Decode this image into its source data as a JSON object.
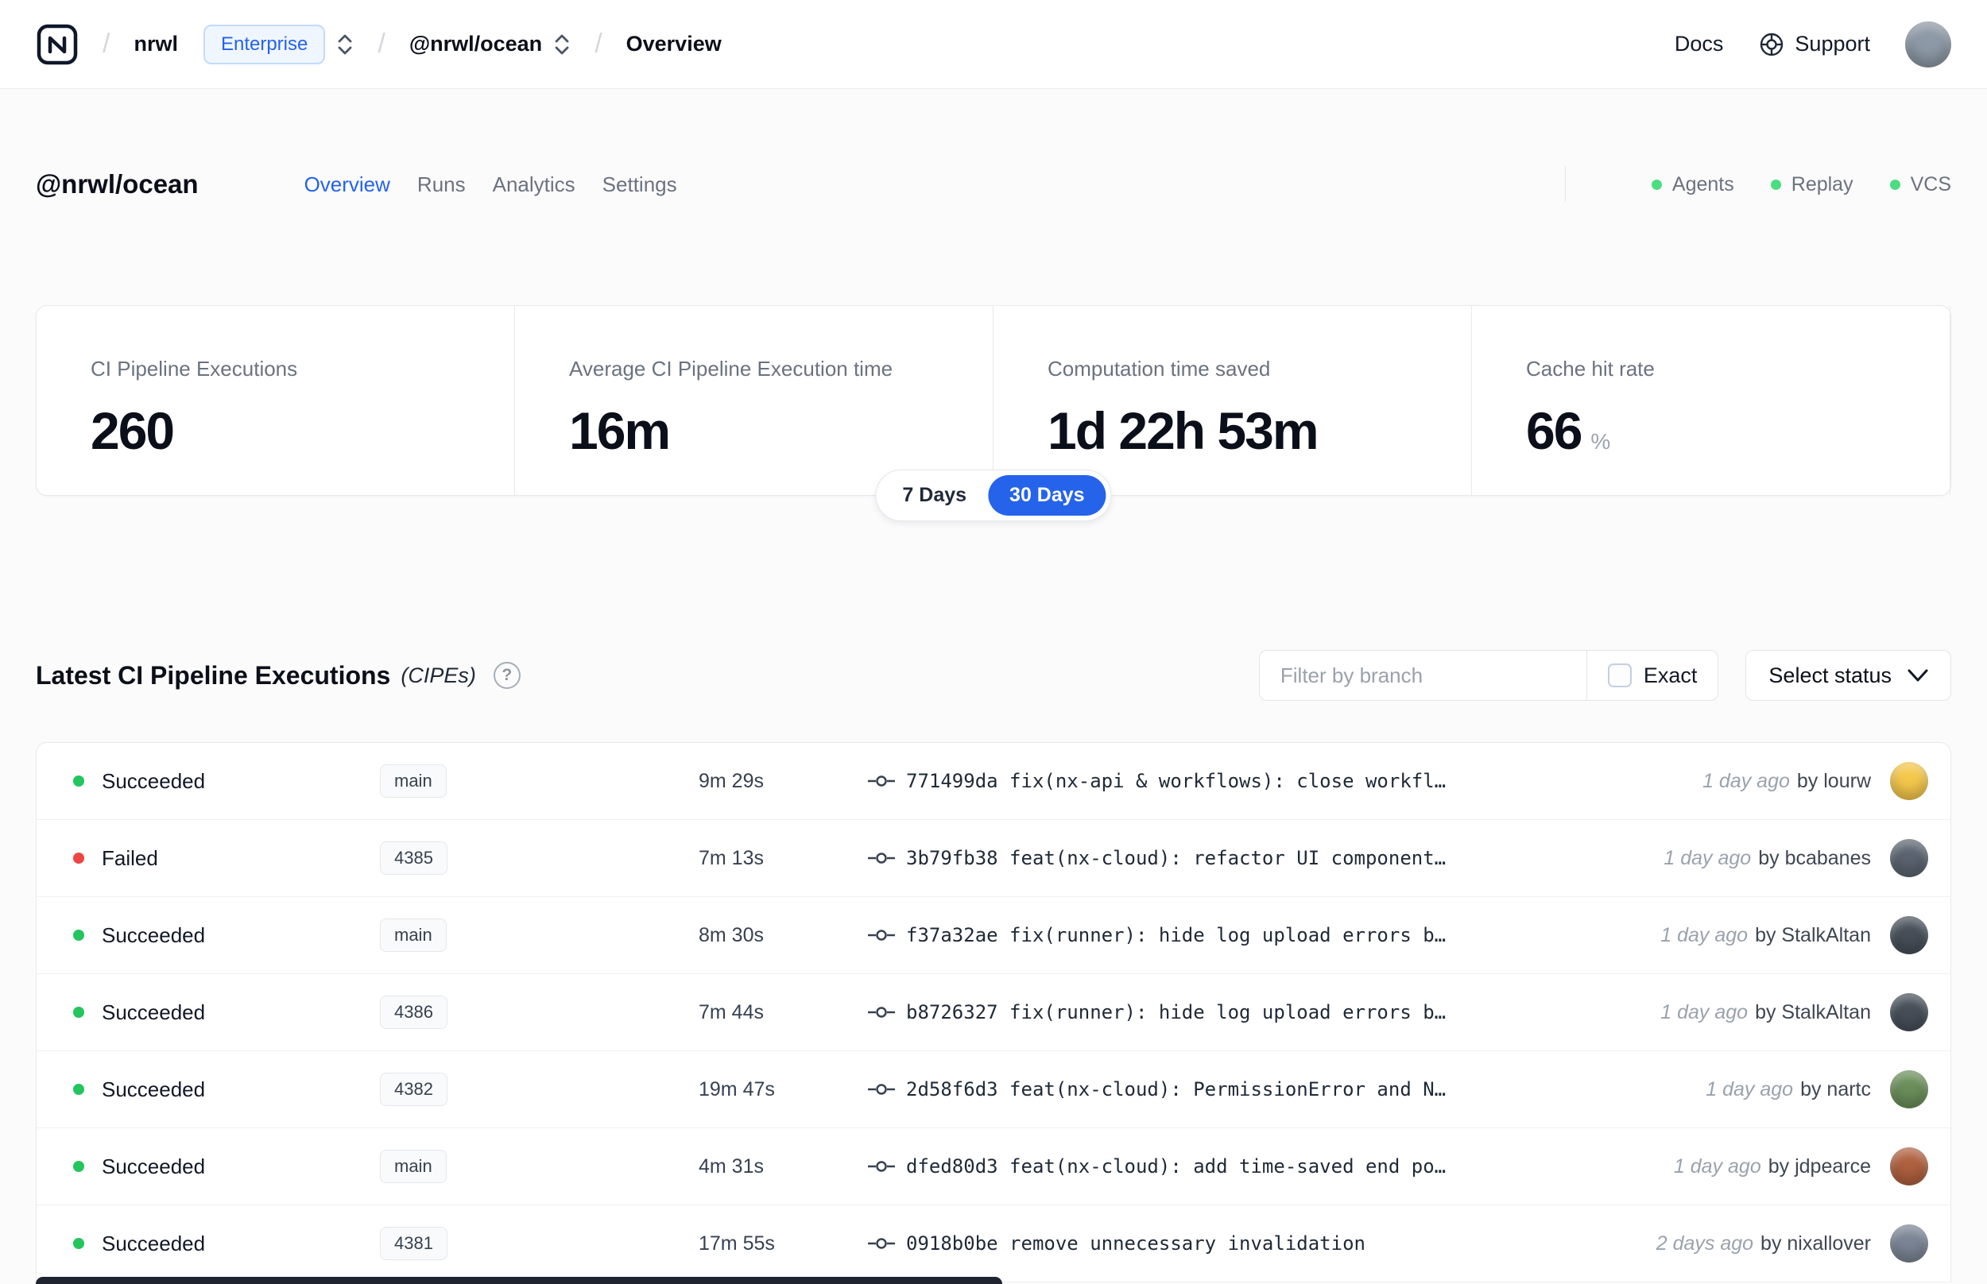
{
  "theme": {
    "accent": "#2563eb",
    "success": "#22c55e",
    "danger": "#ef4444"
  },
  "navbar": {
    "separator": "/",
    "org": "nrwl",
    "org_badge": "Enterprise",
    "workspace": "@nrwl/ocean",
    "current_page": "Overview",
    "docs_label": "Docs",
    "support_label": "Support",
    "avatar_color": "#8d99a6"
  },
  "header": {
    "title": "@nrwl/ocean",
    "tabs": [
      {
        "label": "Overview",
        "active": true
      },
      {
        "label": "Runs",
        "active": false
      },
      {
        "label": "Analytics",
        "active": false
      },
      {
        "label": "Settings",
        "active": false
      }
    ],
    "statuses": [
      {
        "label": "Agents",
        "color": "#4ade80"
      },
      {
        "label": "Replay",
        "color": "#4ade80"
      },
      {
        "label": "VCS",
        "color": "#4ade80"
      }
    ]
  },
  "metrics": {
    "cards": [
      {
        "label": "CI Pipeline Executions",
        "value": "260",
        "suffix": ""
      },
      {
        "label": "Average CI Pipeline Execution time",
        "value": "16m",
        "suffix": ""
      },
      {
        "label": "Computation time saved",
        "value": "1d 22h 53m",
        "suffix": ""
      },
      {
        "label": "Cache hit rate",
        "value": "66",
        "suffix": "%"
      }
    ],
    "range_options": [
      {
        "label": "7 Days",
        "active": false
      },
      {
        "label": "30 Days",
        "active": true
      }
    ]
  },
  "cipes": {
    "title": "Latest CI Pipeline Executions",
    "subtitle": "(CIPEs)",
    "help_icon": "?",
    "filter_placeholder": "Filter by branch",
    "exact_label": "Exact",
    "status_dropdown_label": "Select status",
    "rows": [
      {
        "status": "Succeeded",
        "dot": "#22c55e",
        "branch": "main",
        "duration": "9m 29s",
        "commit": "771499da fix(nx-api & workflows): close workfl…",
        "time": "1 day ago",
        "author": "by lourw",
        "avatar_color": "#f6c84c"
      },
      {
        "status": "Failed",
        "dot": "#ef4444",
        "branch": "4385",
        "duration": "7m 13s",
        "commit": "3b79fb38 feat(nx-cloud): refactor UI component…",
        "time": "1 day ago",
        "author": "by bcabanes",
        "avatar_color": "#5b6470"
      },
      {
        "status": "Succeeded",
        "dot": "#22c55e",
        "branch": "main",
        "duration": "8m 30s",
        "commit": "f37a32ae fix(runner): hide log upload errors b…",
        "time": "1 day ago",
        "author": "by StalkAltan",
        "avatar_color": "#474f59"
      },
      {
        "status": "Succeeded",
        "dot": "#22c55e",
        "branch": "4386",
        "duration": "7m 44s",
        "commit": "b8726327 fix(runner): hide log upload errors b…",
        "time": "1 day ago",
        "author": "by StalkAltan",
        "avatar_color": "#474f59"
      },
      {
        "status": "Succeeded",
        "dot": "#22c55e",
        "branch": "4382",
        "duration": "19m 47s",
        "commit": "2d58f6d3 feat(nx-cloud): PermissionError and N…",
        "time": "1 day ago",
        "author": "by nartc",
        "avatar_color": "#6b8f5a"
      },
      {
        "status": "Succeeded",
        "dot": "#22c55e",
        "branch": "main",
        "duration": "4m 31s",
        "commit": "dfed80d3 feat(nx-cloud): add time-saved end po…",
        "time": "1 day ago",
        "author": "by jdpearce",
        "avatar_color": "#b0613f"
      },
      {
        "status": "Succeeded",
        "dot": "#22c55e",
        "branch": "4381",
        "duration": "17m 55s",
        "commit": "0918b0be remove unnecessary invalidation",
        "time": "2 days ago",
        "author": "by nixallover",
        "avatar_color": "#7c8696"
      }
    ]
  }
}
